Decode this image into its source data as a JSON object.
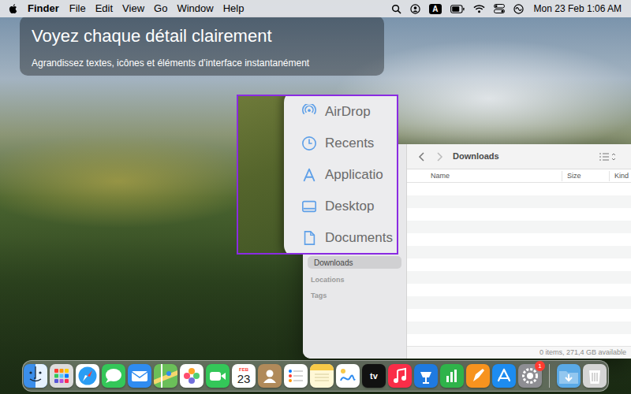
{
  "menu_bar": {
    "app": "Finder",
    "menus": [
      "File",
      "Edit",
      "View",
      "Go",
      "Window",
      "Help"
    ],
    "input_source": "A",
    "clock": "Mon 23 Feb 1:06 AM"
  },
  "banner": {
    "title": "Voyez chaque détail clairement",
    "subtitle": "Agrandissez textes, icônes et éléments d’interface instantanément"
  },
  "magnifier": {
    "items": [
      {
        "label": "AirDrop",
        "kind": "airdrop"
      },
      {
        "label": "Recents",
        "kind": "clock"
      },
      {
        "label": "Applicatio",
        "kind": "apps"
      },
      {
        "label": "Desktop",
        "kind": "desktop"
      },
      {
        "label": "Documents",
        "kind": "doc"
      }
    ]
  },
  "finder": {
    "title": "Downloads",
    "columns": [
      "Name",
      "Size",
      "Kind"
    ],
    "sidebar": {
      "items": [
        {
          "label": "Downloads",
          "selected": true
        }
      ],
      "sections": [
        "Locations",
        "Tags"
      ]
    },
    "status_bar": "0 items, 271,4 GB available"
  },
  "dock": {
    "apps": [
      {
        "kind": "finder",
        "color": "#3b8eea"
      },
      {
        "kind": "launchpad",
        "color": "#dcdcdc"
      },
      {
        "kind": "safari",
        "color": "#ffffff"
      },
      {
        "kind": "messages",
        "color": "#34c759"
      },
      {
        "kind": "mail",
        "color": "#2f8cf0"
      },
      {
        "kind": "maps",
        "color": "#6bbf59"
      },
      {
        "kind": "photos",
        "color": "#ffffff"
      },
      {
        "kind": "facetime",
        "color": "#34c759"
      },
      {
        "kind": "calendar",
        "color": "#ffffff",
        "month": "FEB",
        "day": "23"
      },
      {
        "kind": "contacts",
        "color": "#b08a5a"
      },
      {
        "kind": "reminders",
        "color": "#ffffff"
      },
      {
        "kind": "notes",
        "color": "#fff8d6"
      },
      {
        "kind": "freeform",
        "color": "#ffffff"
      },
      {
        "kind": "tv",
        "color": "#111111",
        "label": "tv"
      },
      {
        "kind": "music",
        "color": "#fa2d48"
      },
      {
        "kind": "keynote",
        "color": "#1f7ae0"
      },
      {
        "kind": "numbers",
        "color": "#2fb34a"
      },
      {
        "kind": "pages",
        "color": "#f7931e"
      },
      {
        "kind": "appstore",
        "color": "#1d8cf0"
      },
      {
        "kind": "settings",
        "color": "#8e8e93",
        "badge": "1"
      }
    ],
    "others": [
      {
        "kind": "folder",
        "color": "#5aa9e6"
      },
      {
        "kind": "trash",
        "color": "#d5d5d5"
      }
    ]
  }
}
